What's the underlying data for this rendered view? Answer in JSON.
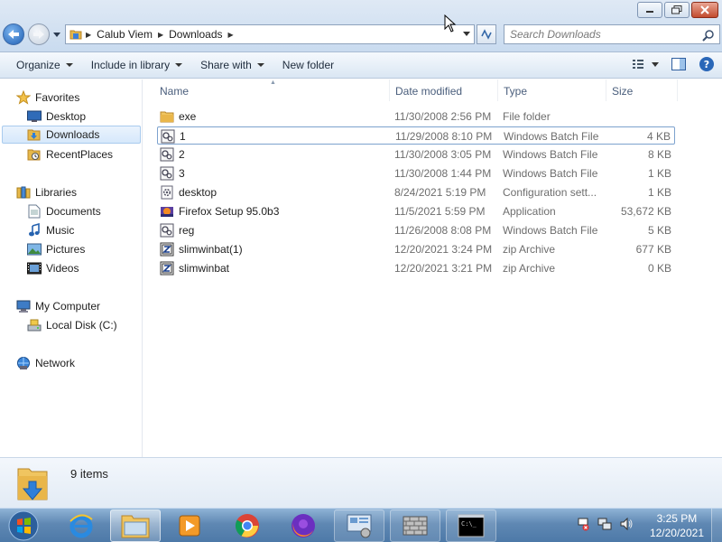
{
  "window": {
    "controls": {
      "minimize_icon": "minimize-icon",
      "maximize_icon": "restore-icon",
      "close_icon": "close-icon"
    }
  },
  "address_bar": {
    "segments": [
      "Calub Viem",
      "Downloads"
    ]
  },
  "search": {
    "placeholder": "Search Downloads"
  },
  "toolbar": {
    "organize": "Organize",
    "include_in_library": "Include in library",
    "share_with": "Share with",
    "new_folder": "New folder"
  },
  "nav_pane": {
    "favorites": {
      "label": "Favorites",
      "items": [
        "Desktop",
        "Downloads",
        "RecentPlaces"
      ]
    },
    "libraries": {
      "label": "Libraries",
      "items": [
        "Documents",
        "Music",
        "Pictures",
        "Videos"
      ]
    },
    "computer": {
      "label": "My Computer",
      "items": [
        "Local Disk (C:)"
      ]
    },
    "network": {
      "label": "Network"
    },
    "selected": "Downloads"
  },
  "columns": {
    "name": "Name",
    "date": "Date modified",
    "type": "Type",
    "size": "Size"
  },
  "files": [
    {
      "name": "exe",
      "date": "11/30/2008 2:56 PM",
      "type": "File folder",
      "size": "",
      "icon": "folder-icon"
    },
    {
      "name": "1",
      "date": "11/29/2008 8:10 PM",
      "type": "Windows Batch File",
      "size": "4 KB",
      "icon": "batch-file-icon"
    },
    {
      "name": "2",
      "date": "11/30/2008 3:05 PM",
      "type": "Windows Batch File",
      "size": "8 KB",
      "icon": "batch-file-icon"
    },
    {
      "name": "3",
      "date": "11/30/2008 1:44 PM",
      "type": "Windows Batch File",
      "size": "1 KB",
      "icon": "batch-file-icon"
    },
    {
      "name": "desktop",
      "date": "8/24/2021 5:19 PM",
      "type": "Configuration sett...",
      "size": "1 KB",
      "icon": "config-file-icon"
    },
    {
      "name": "Firefox Setup 95.0b3",
      "date": "11/5/2021 5:59 PM",
      "type": "Application",
      "size": "53,672 KB",
      "icon": "installer-icon"
    },
    {
      "name": "reg",
      "date": "11/26/2008 8:08 PM",
      "type": "Windows Batch File",
      "size": "5 KB",
      "icon": "batch-file-icon"
    },
    {
      "name": "slimwinbat(1)",
      "date": "12/20/2021 3:24 PM",
      "type": "zip Archive",
      "size": "677 KB",
      "icon": "zip-archive-icon"
    },
    {
      "name": "slimwinbat",
      "date": "12/20/2021 3:21 PM",
      "type": "zip Archive",
      "size": "0 KB",
      "icon": "zip-archive-icon"
    }
  ],
  "focused_row": "1",
  "details": {
    "count": "9 items"
  },
  "taskbar": {
    "apps": [
      "internet-explorer-icon",
      "windows-explorer-icon",
      "media-player-icon",
      "chrome-icon",
      "firefox-icon",
      "control-panel-icon",
      "firewall-icon",
      "command-prompt-icon"
    ],
    "clock_time": "3:25 PM",
    "clock_date": "12/20/2021"
  }
}
